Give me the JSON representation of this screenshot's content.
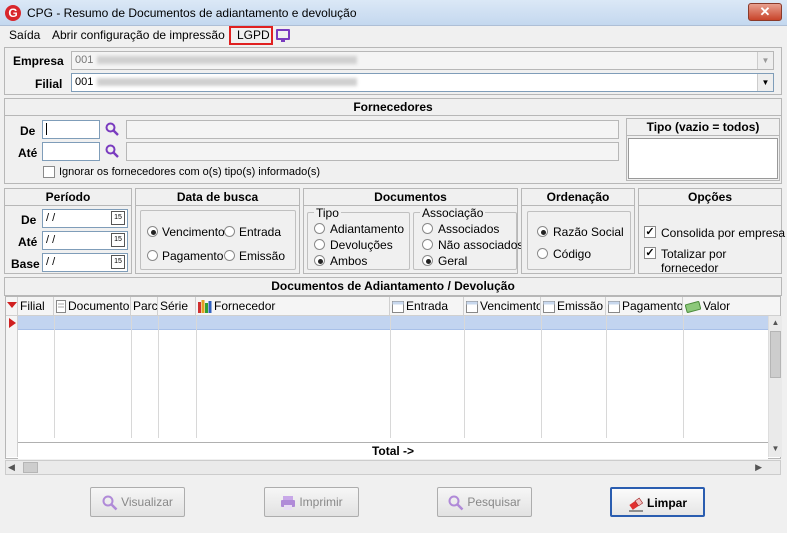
{
  "window": {
    "title": "CPG - Resumo de Documentos de adiantamento e devolução",
    "close": "✕"
  },
  "menu": {
    "items": [
      "Saída",
      "Abrir configuração de impressão",
      "LGPD"
    ]
  },
  "empresa": {
    "label": "Empresa",
    "value": "001"
  },
  "filial": {
    "label": "Filial",
    "value": "001"
  },
  "fornecedores": {
    "title": "Fornecedores",
    "de_label": "De",
    "ate_label": "Até",
    "ignore_label": "Ignorar os fornecedores com o(s) tipo(s) informado(s)",
    "tipo_title": "Tipo (vazio = todos)"
  },
  "periodo": {
    "title": "Período",
    "de_label": "De",
    "ate_label": "Até",
    "base_label": "Base",
    "de_value": " /  /",
    "ate_value": " /  /",
    "base_value": " /  /",
    "cal_icon": "15"
  },
  "data_busca": {
    "title": "Data de busca",
    "options": [
      "Vencimento",
      "Entrada",
      "Pagamento",
      "Emissão"
    ],
    "selected": "Vencimento"
  },
  "documentos": {
    "title": "Documentos",
    "tipo_label": "Tipo",
    "tipo_options": [
      "Adiantamento",
      "Devoluções",
      "Ambos"
    ],
    "tipo_selected": "Ambos",
    "assoc_label": "Associação",
    "assoc_options": [
      "Associados",
      "Não associados",
      "Geral"
    ],
    "assoc_selected": "Geral"
  },
  "ordenacao": {
    "title": "Ordenação",
    "options": [
      "Razão Social",
      "Código"
    ],
    "selected": "Razão Social"
  },
  "opcoes": {
    "title": "Opções",
    "options": [
      "Consolida por empresa",
      "Totalizar por fornecedor"
    ],
    "checked": [
      true,
      true
    ]
  },
  "grid": {
    "title": "Documentos de Adiantamento / Devolução",
    "columns": [
      "Filial",
      "Documento",
      "Parc",
      "Série",
      "Fornecedor",
      "Entrada",
      "Vencimento",
      "Emissão",
      "Pagamento",
      "Valor"
    ],
    "total_label": "Total ->"
  },
  "buttons": {
    "visualizar": "Visualizar",
    "imprimir": "Imprimir",
    "pesquisar": "Pesquisar",
    "limpar": "Limpar"
  },
  "colors": {
    "accent": "#2a5db0",
    "highlight": "#e02020",
    "icon_purple": "#7a3bbf"
  }
}
